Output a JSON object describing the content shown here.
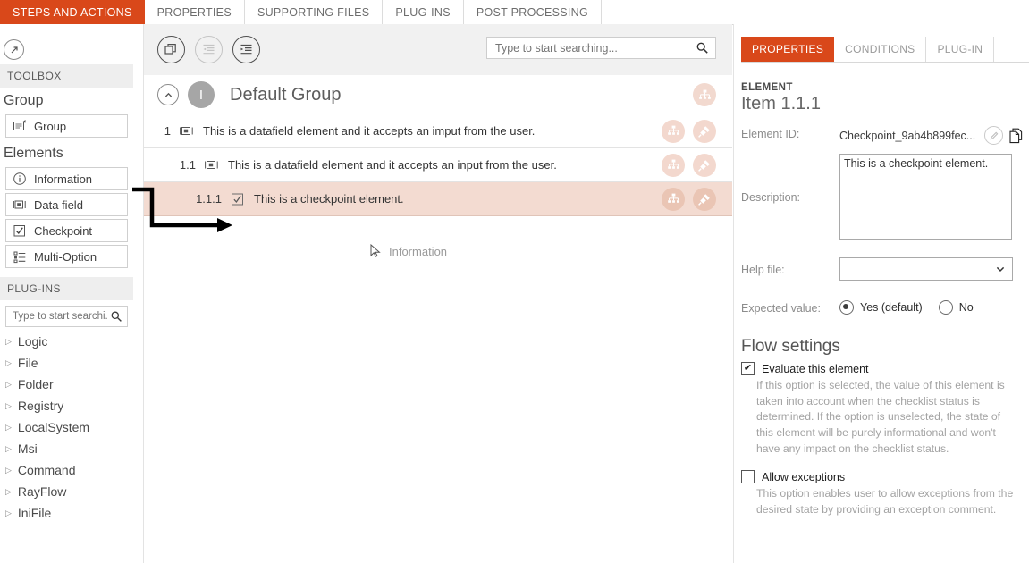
{
  "top_tabs": [
    {
      "label": "STEPS AND ACTIONS",
      "active": true
    },
    {
      "label": "PROPERTIES",
      "active": false
    },
    {
      "label": "SUPPORTING FILES",
      "active": false
    },
    {
      "label": "PLUG-INS",
      "active": false
    },
    {
      "label": "POST PROCESSING",
      "active": false
    }
  ],
  "sidebar": {
    "collapse_icon": "collapse-panel-icon",
    "toolbox_header": "TOOLBOX",
    "group_header": "Group",
    "group_item": {
      "label": "Group",
      "icon": "group-icon"
    },
    "elements_header": "Elements",
    "elements": [
      {
        "label": "Information",
        "icon": "information-icon"
      },
      {
        "label": "Data field",
        "icon": "data-field-icon"
      },
      {
        "label": "Checkpoint",
        "icon": "checkpoint-icon"
      },
      {
        "label": "Multi-Option",
        "icon": "multi-option-icon"
      }
    ],
    "plugins_header": "PLUG-INS",
    "plugins_search_placeholder": "Type to start searchi...",
    "plugins_search_value": "",
    "plugins": [
      {
        "label": "Logic"
      },
      {
        "label": "File"
      },
      {
        "label": "Folder"
      },
      {
        "label": "Registry"
      },
      {
        "label": "LocalSystem"
      },
      {
        "label": "Msi"
      },
      {
        "label": "Command"
      },
      {
        "label": "RayFlow"
      },
      {
        "label": "IniFile"
      }
    ]
  },
  "center": {
    "toolbar_buttons": [
      {
        "name": "duplicate-button",
        "icon": "duplicate-icon",
        "enabled": true
      },
      {
        "name": "outdent-button",
        "icon": "outdent-icon",
        "enabled": false
      },
      {
        "name": "indent-button",
        "icon": "indent-icon",
        "enabled": true
      }
    ],
    "search_placeholder": "Type to start searching...",
    "search_value": "",
    "group": {
      "title": "Default Group",
      "avatar_letter": "I",
      "chevron_icon": "chevron-up-icon",
      "action_icon": "hierarchy-icon"
    },
    "rows": [
      {
        "number": "1",
        "icon": "data-field-icon",
        "label": "This is a datafield element and it accepts an imput from the user.",
        "selected": false,
        "actions": [
          "hierarchy-icon",
          "plugin-icon"
        ]
      },
      {
        "number": "1.1",
        "icon": "data-field-icon",
        "label": "This is a datafield element and it accepts an input from the user.",
        "selected": false,
        "actions": [
          "hierarchy-icon",
          "plugin-icon"
        ]
      },
      {
        "number": "1.1.1",
        "icon": "checkpoint-icon",
        "label": "This is a checkpoint element.",
        "selected": true,
        "actions": [
          "hierarchy-icon",
          "plugin-icon"
        ]
      }
    ],
    "drag_ghost": {
      "label": "Information",
      "cursor_icon": "cursor-arrow-icon"
    }
  },
  "right": {
    "tabs": [
      {
        "label": "PROPERTIES",
        "active": true
      },
      {
        "label": "CONDITIONS",
        "active": false
      },
      {
        "label": "PLUG-IN",
        "active": false
      }
    ],
    "element_kicker": "ELEMENT",
    "element_title": "Item  1.1.1",
    "element_id_label": "Element ID:",
    "element_id_value": "Checkpoint_9ab4b899fec...",
    "edit_icon": "pencil-icon",
    "copy_icon": "copy-icon",
    "description_label": "Description:",
    "description_value": "This is a checkpoint element.",
    "help_file_label": "Help file:",
    "help_file_value": "",
    "help_file_caret": "chevron-down-icon",
    "expected_value_label": "Expected value:",
    "expected_options": [
      {
        "label": "Yes (default)",
        "selected": true
      },
      {
        "label": "No",
        "selected": false
      }
    ],
    "flow_settings_header": "Flow settings",
    "evaluate": {
      "label": "Evaluate this element",
      "checked": true,
      "help": "If this option is selected, the value of this element is taken into account when the checklist status is determined. If the option is unselected, the state of this element will be purely informational and won't have any impact on the checklist status."
    },
    "allow_exceptions": {
      "label": "Allow exceptions",
      "checked": false,
      "help": "This option enables user to allow exceptions from the desired state by providing an exception comment."
    }
  },
  "colors": {
    "accent": "#d9481a",
    "selected_row": "#f3dbd1",
    "action_circle": "#f3d8ce",
    "section_header_bg": "#eeeeee"
  }
}
